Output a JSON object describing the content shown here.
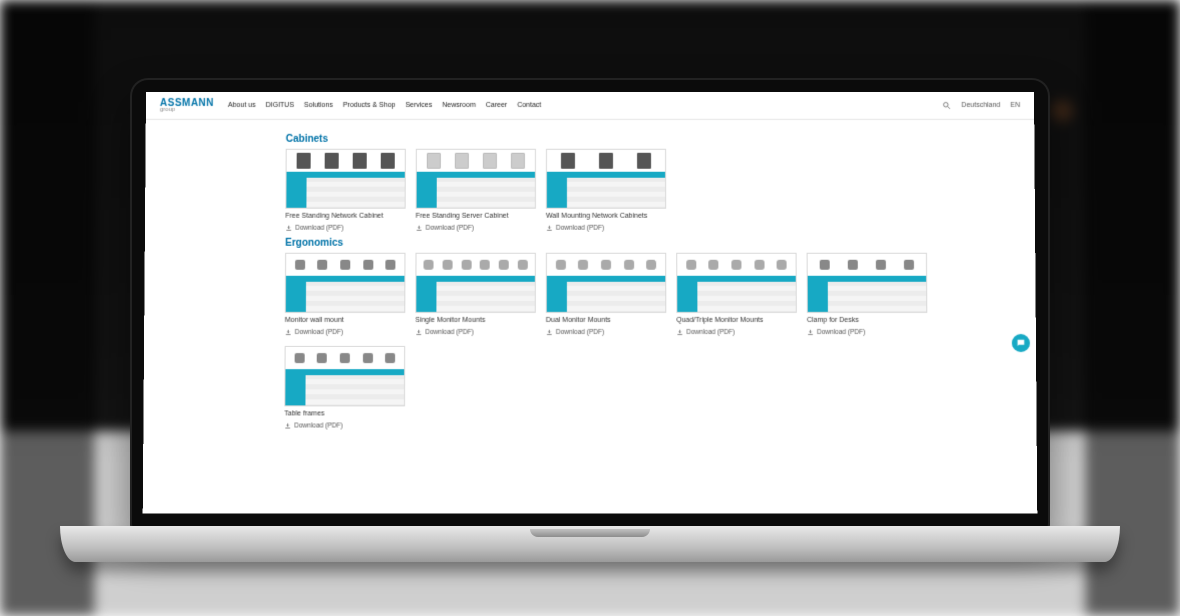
{
  "logo": {
    "brand": "ASSMANN",
    "sub": "group"
  },
  "nav": [
    "About us",
    "DIGITUS",
    "Solutions",
    "Products & Shop",
    "Services",
    "Newsroom",
    "Career",
    "Contact"
  ],
  "header_right": {
    "country": "Deutschland",
    "lang": "EN"
  },
  "download_label": "Download (PDF)",
  "sections": [
    {
      "title": "Cabinets",
      "items": [
        {
          "title": "Free Standing Network Cabinet",
          "thumb": "dark"
        },
        {
          "title": "Free Standing Server Cabinet",
          "thumb": "light"
        },
        {
          "title": "Wall Mounting Network Cabinets",
          "thumb": "dark"
        }
      ]
    },
    {
      "title": "Ergonomics",
      "items": [
        {
          "title": "Monitor wall mount",
          "thumb": "icons"
        },
        {
          "title": "Single Monitor Mounts",
          "thumb": "icons2"
        },
        {
          "title": "Dual Monitor Mounts",
          "thumb": "icons2"
        },
        {
          "title": "Quad/Triple Monitor Mounts",
          "thumb": "icons2"
        },
        {
          "title": "Clamp for Desks",
          "thumb": "icons"
        },
        {
          "title": "Table frames",
          "thumb": "icons"
        }
      ]
    }
  ]
}
